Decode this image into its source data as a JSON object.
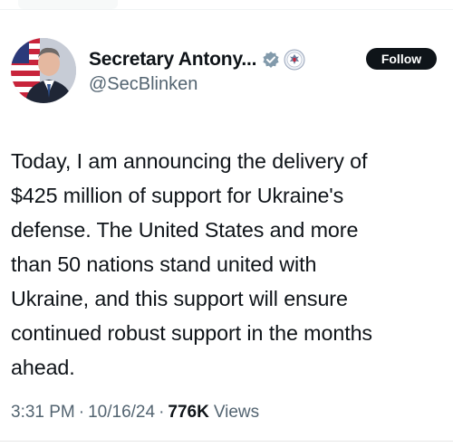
{
  "post": {
    "author": {
      "display_name": "Secretary Antony...",
      "handle": "@SecBlinken",
      "verified_icon": "verified-badge-icon",
      "affiliate_icon": "state-department-seal-icon",
      "verified_color": "#829aab"
    },
    "follow_label": "Follow",
    "text": "Today, I am announcing the delivery of\n$425 million of support for Ukraine's\ndefense. The United States and more\nthan 50 nations stand united with\nUkraine, and this support will ensure\ncontinued robust support in the months\nahead.",
    "meta": {
      "time": "3:31 PM",
      "separator": "·",
      "date": "10/16/24",
      "views_count": "776K",
      "views_label": "Views"
    }
  }
}
